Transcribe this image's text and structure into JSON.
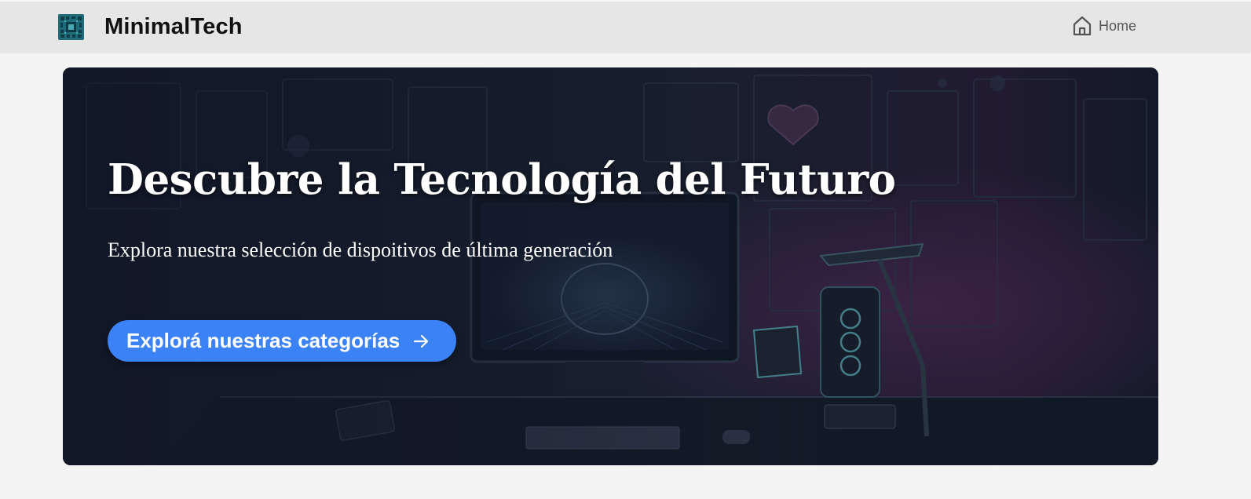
{
  "header": {
    "brand_name": "MinimalTech",
    "nav": {
      "home_label": "Home",
      "home_icon": "house-icon"
    },
    "logo_icon": "circuit-chip-icon"
  },
  "hero": {
    "title": "Descubre la Tecnología del Futuro",
    "subtitle": "Explora nuestra selección de dispoitivos de última generación",
    "cta_label": "Explorá nuestras categorías",
    "cta_icon": "arrow-right-icon",
    "background_image": "dark-tech-desk-illustration"
  },
  "colors": {
    "navbar_bg": "#e6e6e6",
    "page_bg": "#f4f4f4",
    "hero_bg": "#121a2b",
    "cta_bg": "#3b82f6",
    "logo": "#1f6b78"
  }
}
